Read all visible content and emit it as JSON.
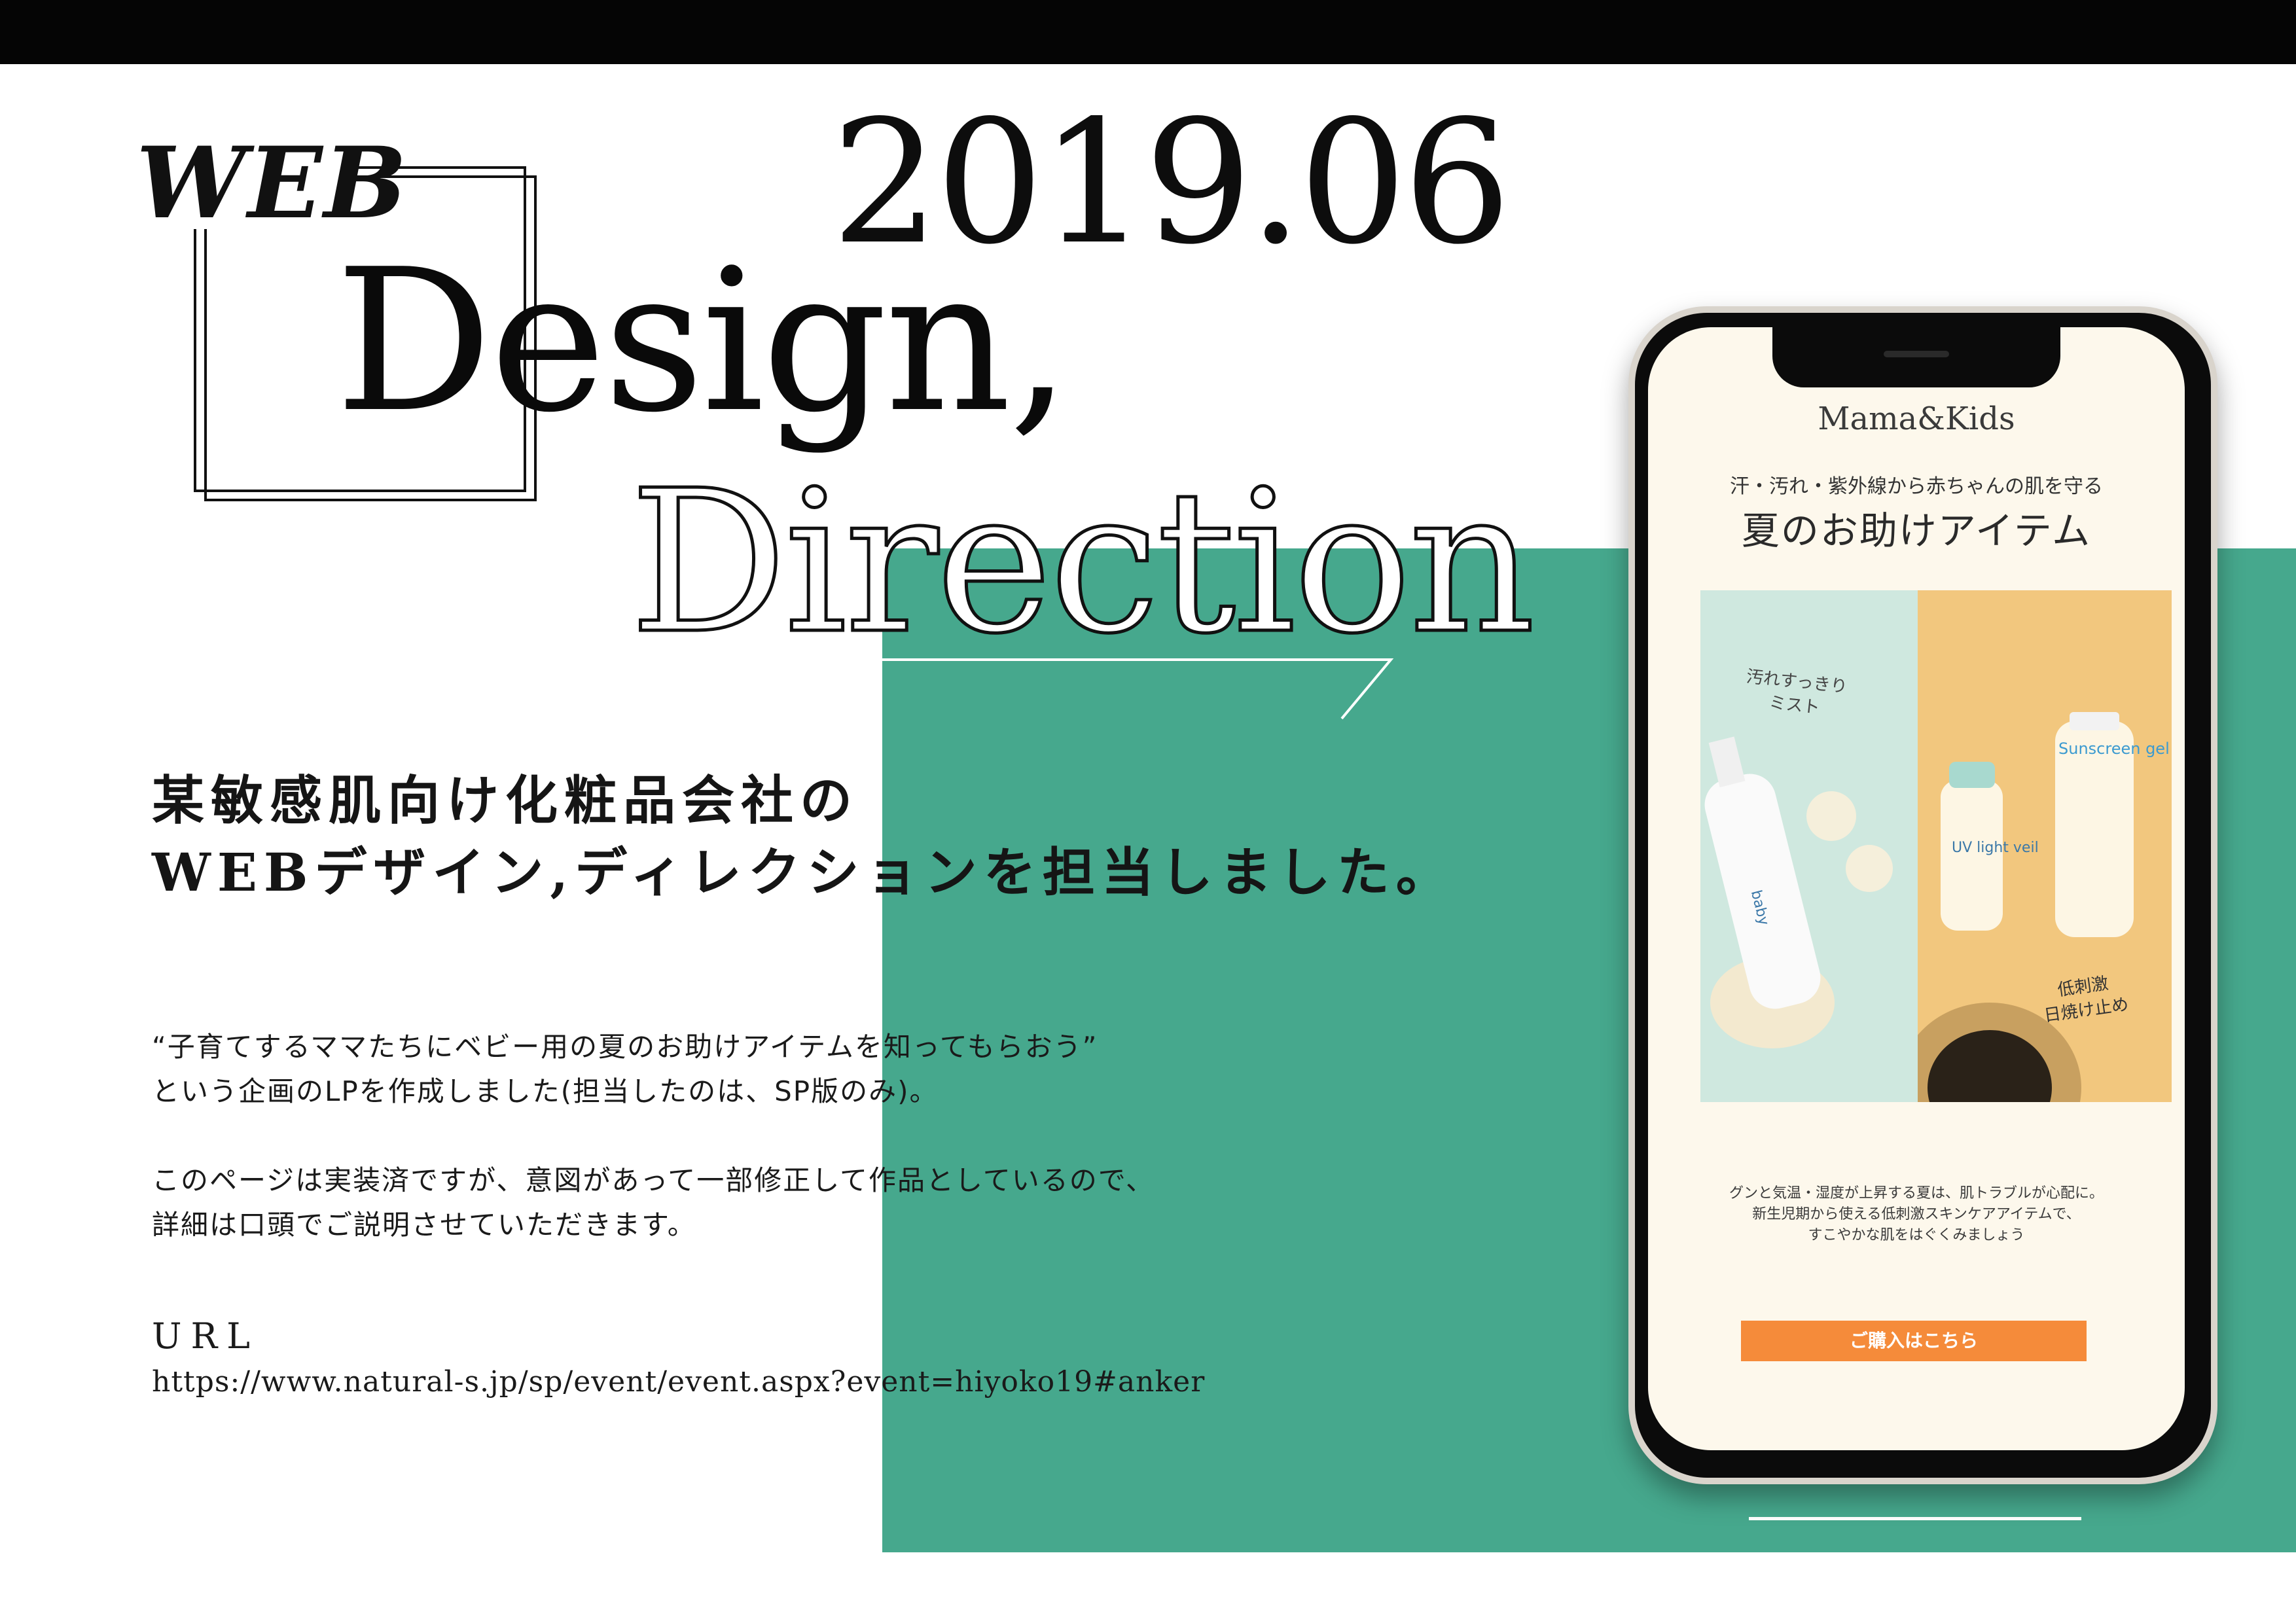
{
  "header": {
    "label_web": "WEB",
    "year": "2019.06",
    "title_line1": "Design,",
    "title_line2": "Direction"
  },
  "intro": {
    "lead_line1": "某敏感肌向け化粧品会社の",
    "lead_line2": "WEBデザイン,ディレクションを担当しました。"
  },
  "description": {
    "para1_line1": "“子育てするママたちにベビー用の夏のお助けアイテムを知ってもらおう”",
    "para1_line2": "という企画のLPを作成しました(担当したのは、SP版のみ)。",
    "para2_line1": "このページは実装済ですが、意図があって一部修正して作品としているので、",
    "para2_line2": "詳細は口頭でご説明させていただきます。"
  },
  "link": {
    "label": "URL",
    "url": "https://www.natural-s.jp/sp/event/event.aspx?event=hiyoko19#anker"
  },
  "phone_screen": {
    "brand": "Mama&Kids",
    "subtitle": "汗・汚れ・紫外線から赤ちゃんの肌を守る",
    "title": "夏のお助けアイテム",
    "handwritten_left_1": "汚れすっきり",
    "handwritten_left_2": "ミスト",
    "handwritten_right_1": "低刺激",
    "handwritten_right_2": "日焼け止め",
    "product_left_text": "baby",
    "product_right_text": "Sunscreen gel",
    "product_mid_text": "UV light veil",
    "body_line1": "グンと気温・湿度が上昇する夏は、肌トラブルが心配に。",
    "body_line2": "新生児期から使える低刺激スキンケアアイテムで、",
    "body_line3": "すこやかな肌をはぐくみましょう",
    "cta": "ご購入はこちら"
  },
  "colors": {
    "background": "#ffffff",
    "top_bar": "#050505",
    "green_panel": "#46a88d",
    "cta_orange": "#f58b3a",
    "screen_cream": "#fdf8ec"
  }
}
